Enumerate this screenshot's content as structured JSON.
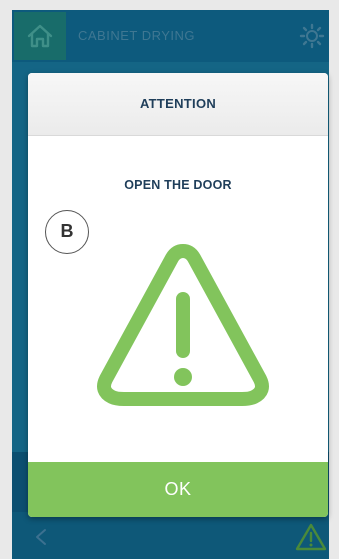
{
  "app": {
    "title": "CABINET DRYING"
  },
  "icons": {
    "home": "home-icon",
    "settings": "gear-icon",
    "back": "chevron-left-icon",
    "warning_small": "warning-triangle-icon",
    "warning_large": "warning-triangle-icon"
  },
  "dialog": {
    "title": "ATTENTION",
    "message": "OPEN THE DOOR",
    "callout_label": "B",
    "ok_label": "OK"
  },
  "colors": {
    "accent_green": "#82c45c",
    "warning_green": "#82c45c",
    "app_blue": "#0f5d82",
    "text_dark_blue": "#1f3e5a"
  }
}
